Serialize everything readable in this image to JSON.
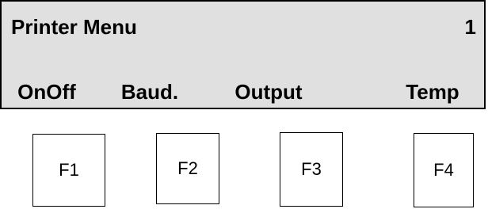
{
  "display": {
    "title": "Printer Menu",
    "page_number": "1",
    "background_color": "#e0e0e0",
    "softkeys": [
      {
        "label": "OnOff"
      },
      {
        "label": "Baud."
      },
      {
        "label": "Output"
      },
      {
        "label": "Temp"
      }
    ]
  },
  "function_keys": [
    {
      "label": "F1"
    },
    {
      "label": "F2"
    },
    {
      "label": "F3"
    },
    {
      "label": "F4"
    }
  ]
}
